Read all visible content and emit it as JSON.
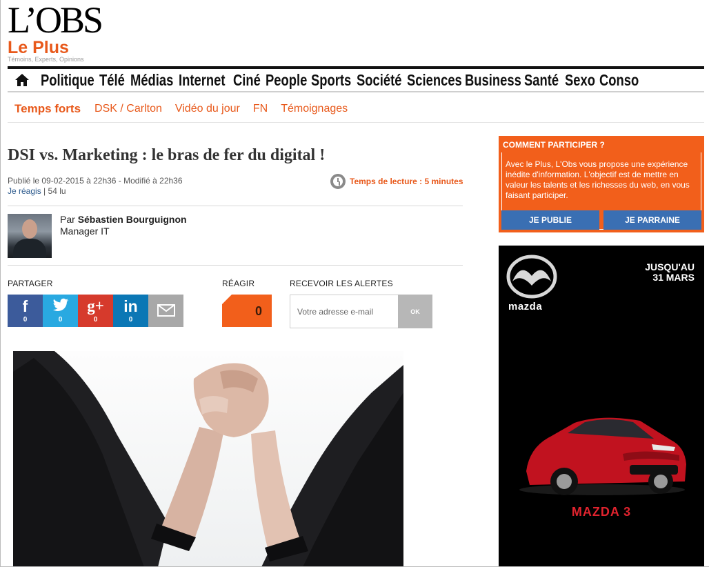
{
  "header": {
    "logo": "L’OBS",
    "section": "Le Plus",
    "tagline": "Témoins, Experts, Opinions"
  },
  "main_nav": {
    "home_icon": "home-icon",
    "items": [
      "Politique",
      "Télé",
      "Médias",
      "Internet",
      "Ciné",
      "People",
      "Sports",
      "Société",
      "Sciences",
      "Business",
      "Santé",
      "Sexo",
      "Conso"
    ]
  },
  "sub_nav": {
    "items": [
      "Temps forts",
      "DSK / Carlton",
      "Vidéo du jour",
      "FN",
      "Témoignages"
    ]
  },
  "article": {
    "title": "DSI vs. Marketing : le bras de fer du digital !",
    "published": "Publié le 09-02-2015 à 22h36 - Modifié à 22h36",
    "react_link": "Je réagis",
    "separator": "|",
    "reads": "54 lu",
    "reading_time": "Temps de lecture : 5 minutes",
    "author_prefix": "Par",
    "author_name": "Sébastien Bourguignon",
    "author_role": "Manager IT"
  },
  "share": {
    "label": "PARTAGER",
    "buttons": [
      {
        "icon": "f",
        "count": "0"
      },
      {
        "icon": "🐦",
        "count": "0"
      },
      {
        "icon": "g+",
        "count": "0"
      },
      {
        "icon": "in",
        "count": "0"
      },
      {
        "icon": "✉",
        "count": ""
      }
    ]
  },
  "react": {
    "label": "RÉAGIR",
    "count": "0"
  },
  "alerts": {
    "label": "RECEVOIR LES ALERTES",
    "placeholder": "Votre adresse e-mail",
    "button": "OK"
  },
  "participate": {
    "heading": "COMMENT PARTICIPER ?",
    "text": "Avec le Plus, L'Obs vous propose une expérience inédite d'information. L'objectif est de mettre en valeur les talents et les richesses du web, en vous faisant participer.",
    "publish_button": "JE PUBLIE",
    "sponsor_button": "JE PARRAINE"
  },
  "ad": {
    "brand": "mazda",
    "promo_line1": "JUSQU'AU",
    "promo_line2": "31 MARS",
    "model": "MAZDA 3"
  },
  "colors": {
    "accent": "#e8591b",
    "orange_box": "#f25f1b",
    "facebook": "#3c5b9b",
    "twitter": "#29a9e1",
    "googleplus": "#d63a2c",
    "linkedin": "#0b77b5",
    "blue_button": "#3a6fb3"
  }
}
